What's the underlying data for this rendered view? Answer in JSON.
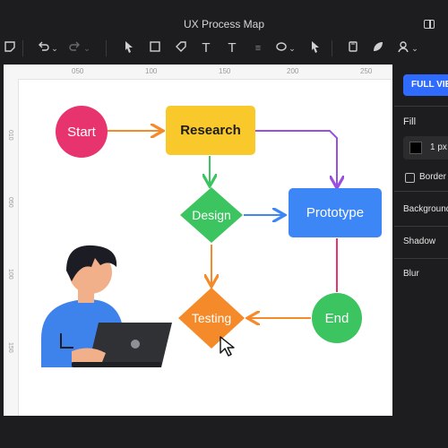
{
  "window": {
    "title": "UX Process Map"
  },
  "toolbar": {
    "icons": [
      "sticky-note-icon",
      "undo-icon",
      "chevron-down-icon",
      "redo-icon",
      "chevron-down-icon",
      "pointer-icon",
      "rectangle-icon",
      "tag-icon",
      "text-icon",
      "text-icon",
      "align-icon",
      "layers-icon",
      "chevron-down-icon",
      "link-icon",
      "chevron-down-icon",
      "arrow-icon",
      "frame-icon",
      "leaf-icon",
      "user-icon",
      "chevron-down-icon"
    ]
  },
  "ruler": {
    "top": [
      "050",
      "100",
      "150",
      "200",
      "250"
    ],
    "left": [
      "010",
      "050",
      "100",
      "150"
    ]
  },
  "flowchart": {
    "start": "Start",
    "research": "Research",
    "design": "Design",
    "prototype": "Prototype",
    "testing": "Testing",
    "end": "End",
    "colors": {
      "start": "#e8346e",
      "research": "#f9c82a",
      "design": "#3cc460",
      "prototype": "#3d86f5",
      "testing": "#f58a2b",
      "end": "#3cc460"
    }
  },
  "panel": {
    "full_view_button": "FULL VIEW",
    "fill_label": "Fill",
    "stroke_width": "1 px",
    "border_label": "Border",
    "background_label": "Background",
    "shadow_label": "Shadow",
    "blur_label": "Blur"
  }
}
